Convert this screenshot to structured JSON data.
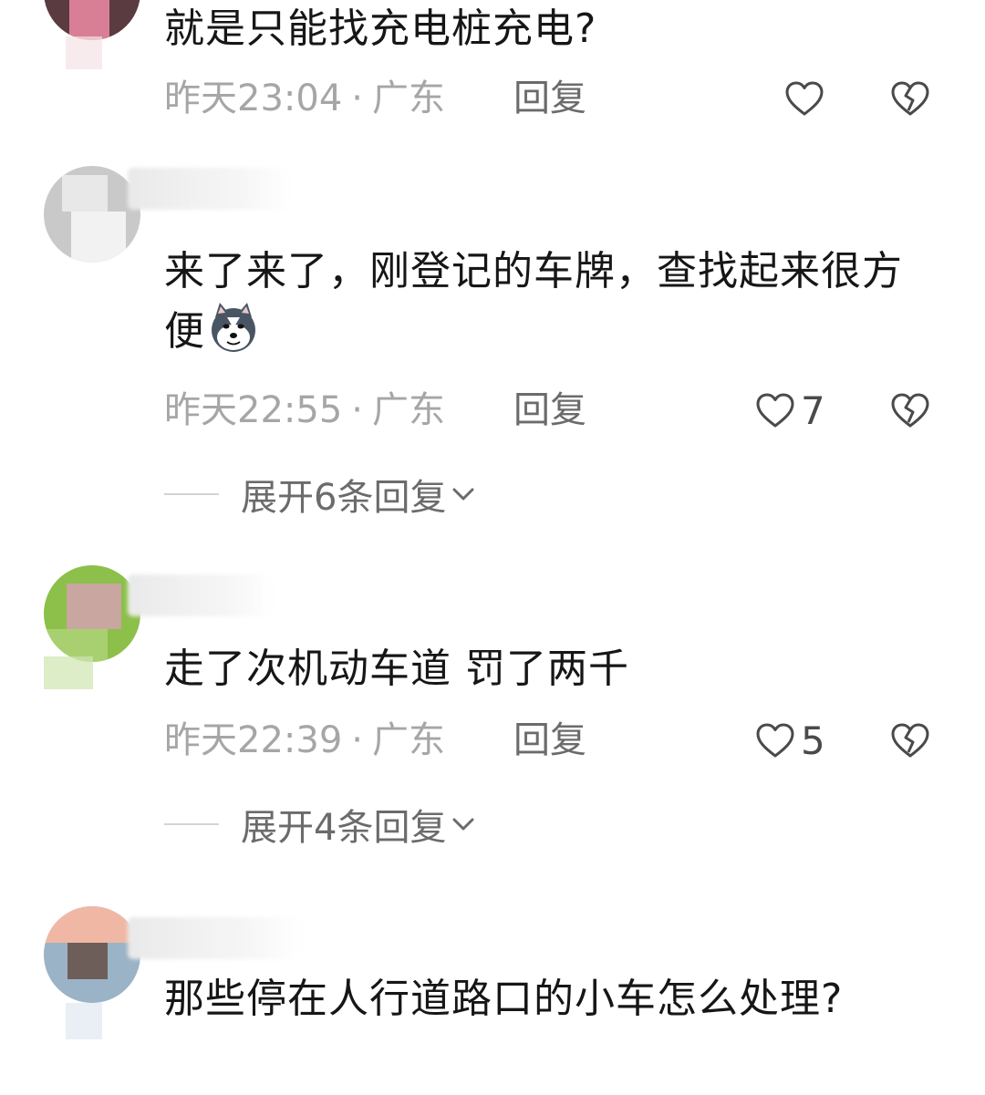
{
  "comments": [
    {
      "text": "就是只能找充电桩充电?",
      "time": "昨天23:04",
      "separator": "·",
      "location": "广东",
      "reply_label": "回复",
      "likes": ""
    },
    {
      "text": "来了来了，刚登记的车牌，查找起来很方便",
      "emoji": "husky-doge-emoji",
      "time": "昨天22:55",
      "separator": "·",
      "location": "广东",
      "reply_label": "回复",
      "likes": "7",
      "expand_label": "展开6条回复"
    },
    {
      "text": "走了次机动车道 罚了两千",
      "time": "昨天22:39",
      "separator": "·",
      "location": "广东",
      "reply_label": "回复",
      "likes": "5",
      "expand_label": "展开4条回复"
    },
    {
      "text": "那些停在人行道路口的小车怎么处理?"
    }
  ],
  "icons": {
    "like": "heart-outline-icon",
    "dislike": "broken-heart-icon",
    "expand": "chevron-down-icon"
  },
  "colors": {
    "text_primary": "#161616",
    "text_meta": "#a6a6a6",
    "text_action": "#6b6b6b"
  }
}
